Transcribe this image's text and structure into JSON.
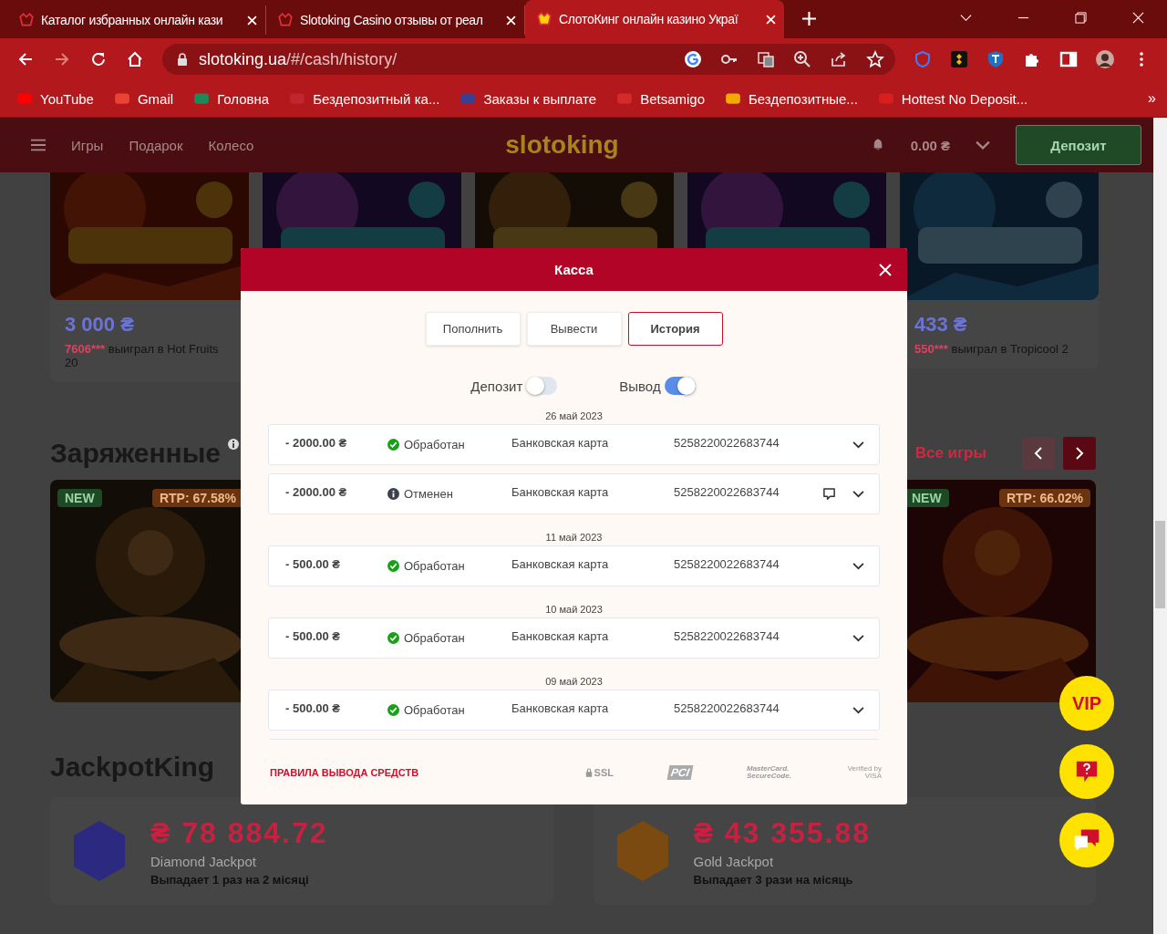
{
  "browser": {
    "tabs": [
      {
        "title": "Каталог избранных онлайн кази",
        "selected": false
      },
      {
        "title": "Slotoking Casino отзывы от реал",
        "selected": false
      },
      {
        "title": "СлотоКинг онлайн казино Украї",
        "selected": true
      }
    ],
    "url_host": "slotoking.ua",
    "url_path": "/#/cash/history/",
    "bookmarks": [
      {
        "label": "YouTube",
        "color": "#ff0000"
      },
      {
        "label": "Gmail",
        "color": "#ea4335"
      },
      {
        "label": "Головна",
        "color": "#1a8a5a"
      },
      {
        "label": "Бездепозитный ка...",
        "color": "#c0262f"
      },
      {
        "label": "Заказы к выплате",
        "color": "#3b3f8f"
      },
      {
        "label": "Betsamigo",
        "color": "#d42a2a"
      },
      {
        "label": "Бездепозитные...",
        "color": "#f2a900"
      },
      {
        "label": "Hottest No Deposit...",
        "color": "#d81e1e"
      }
    ],
    "more": "»"
  },
  "site_header": {
    "nav": [
      "Игры",
      "Подарок",
      "Колесо"
    ],
    "logo": "slotoking",
    "balance": "0.00 ₴",
    "deposit": "Депозит"
  },
  "top_games": [
    {
      "kind": "picture",
      "amount": "3 000 ₴",
      "user": "7606***",
      "text": " выиграл в Hot Fruits 20"
    },
    {
      "kind": "picture"
    },
    {
      "kind": "picture"
    },
    {
      "kind": "picture"
    },
    {
      "kind": "picture",
      "amount": "433 ₴",
      "user": "550***",
      "text": " выиграл в Tropicool 2"
    }
  ],
  "charged": {
    "title": "Заряженные",
    "all": "Все игры",
    "games": [
      {
        "badge": "NEW",
        "rtp": "RTP: 67.58%"
      },
      {
        "badge": "NEW",
        "rtp": "RTP: 66.02%"
      }
    ]
  },
  "jackpot": {
    "title": "JackpotKing",
    "items": [
      {
        "color": "#2c2a80",
        "amount": "₴ 78 884.72",
        "name": "Diamond Jackpot",
        "note": "Выпадает 1 раз на 2 місяці"
      },
      {
        "color": "#7a4a10",
        "amount": "₴ 43 355.88",
        "name": "Gold Jackpot",
        "note": "Выпадает 3 рази на місяць"
      }
    ]
  },
  "modal": {
    "title": "Касса",
    "tabs": [
      {
        "label": "Пополнить",
        "selected": false
      },
      {
        "label": "Вывести",
        "selected": false
      },
      {
        "label": "История",
        "selected": true
      }
    ],
    "filters": [
      {
        "label": "Депозит",
        "on": false
      },
      {
        "label": "Вывод",
        "on": true
      }
    ],
    "groups": [
      {
        "date": "26 май 2023",
        "rows": [
          {
            "amount": "- 2000.00 ₴",
            "kind": "ok",
            "status": "Обработан",
            "method": "Банковская карта",
            "card": "5258220022683744",
            "comment": false
          },
          {
            "amount": "- 2000.00 ₴",
            "kind": "info",
            "status": "Отменен",
            "method": "Банковская карта",
            "card": "5258220022683744",
            "comment": true
          }
        ]
      },
      {
        "date": "11 май 2023",
        "rows": [
          {
            "amount": "- 500.00 ₴",
            "kind": "ok",
            "status": "Обработан",
            "method": "Банковская карта",
            "card": "5258220022683744",
            "comment": false
          }
        ]
      },
      {
        "date": "10 май 2023",
        "rows": [
          {
            "amount": "- 500.00 ₴",
            "kind": "ok",
            "status": "Обработан",
            "method": "Банковская карта",
            "card": "5258220022683744",
            "comment": false
          }
        ]
      },
      {
        "date": "09 май 2023",
        "rows": [
          {
            "amount": "- 500.00 ₴",
            "kind": "ok",
            "status": "Обработан",
            "method": "Банковская карта",
            "card": "5258220022683744",
            "comment": false
          }
        ]
      }
    ],
    "rules_link": "ПРАВИЛА ВЫВОДА СРЕДСТВ",
    "badges": [
      "SSL",
      "PCI",
      "MasterCard. SecureCode.",
      "Verified by VISA"
    ]
  },
  "vip": "VIP"
}
